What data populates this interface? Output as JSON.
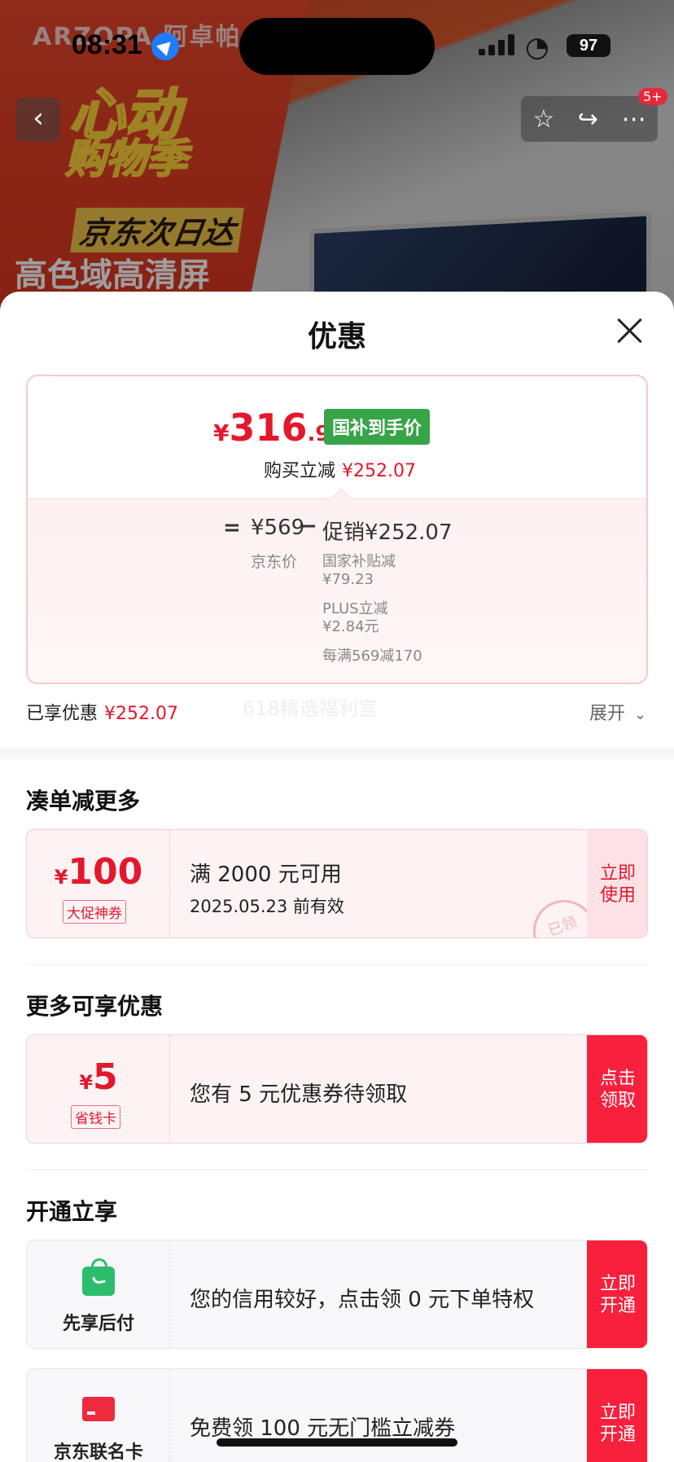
{
  "status_bar": {
    "time": "08:31",
    "battery": "97"
  },
  "background": {
    "brand": "ARZOPA 阿卓帕",
    "promo_line1": "心动",
    "promo_line2": "购物季",
    "promo_line3": "京东次日达",
    "promo_line4": "高色域高清屏",
    "cart_badge": "5+"
  },
  "sheet": {
    "title": "优惠",
    "price": {
      "yen": "¥",
      "integer": "316",
      "decimal": ".93",
      "tag": "国补到手价",
      "buy_label": "购买立减",
      "buy_amount": "¥252.07"
    },
    "breakdown": {
      "equals": "=",
      "jd_price": "¥569",
      "jd_price_label": "京东价",
      "minus": "−",
      "promo_total": "促销¥252.07",
      "details": [
        {
          "name": "国家补贴减",
          "value": "¥79.23"
        },
        {
          "name": "PLUS立减",
          "value": "¥2.84元"
        },
        {
          "name": "每满569减170",
          "value": ""
        }
      ]
    },
    "enjoyed_label": "已享优惠",
    "enjoyed_amount": "¥252.07",
    "ghost_text": "618精选福利宫",
    "expand_label": "展开",
    "sections": {
      "combine": {
        "title": "凑单减更多",
        "coupon": {
          "yen": "¥",
          "amount": "100",
          "tag": "大促神券",
          "line1": "满 2000 元可用",
          "line2": "2025.05.23 前有效",
          "action": "立即\n使用",
          "stamp": "已领"
        }
      },
      "more": {
        "title": "更多可享优惠",
        "coupon": {
          "yen": "¥",
          "amount": "5",
          "tag": "省钱卡",
          "text": "您有 5 元优惠券待领取",
          "action": "点击\n领取"
        }
      },
      "open": {
        "title": "开通立享",
        "items": [
          {
            "label": "先享后付",
            "icon": "shopping-bag-icon",
            "text": "您的信用较好，点击领 0 元下单特权",
            "action": "立即\n开通"
          },
          {
            "label": "京东联名卡",
            "icon": "credit-card-icon",
            "text": "免费领 100 元无门槛立减券",
            "action": "立即\n开通"
          }
        ]
      }
    }
  },
  "colors": {
    "accent_red": "#e3182d",
    "action_red": "#f8203d",
    "tag_green": "#37a447"
  }
}
